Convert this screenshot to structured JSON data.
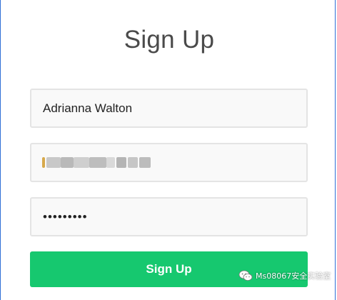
{
  "form": {
    "title": "Sign Up",
    "name_value": "Adrianna Walton",
    "email_value": "",
    "password_value": "123456789",
    "submit_label": "Sign Up"
  },
  "watermark": {
    "text": "Ms08067安全实验室",
    "icon": "wechat-icon"
  },
  "colors": {
    "accent_button": "#16c86f",
    "panel_border": "#2f6fd6",
    "field_background": "#f9f9f9",
    "field_border": "#e4e4e4"
  }
}
